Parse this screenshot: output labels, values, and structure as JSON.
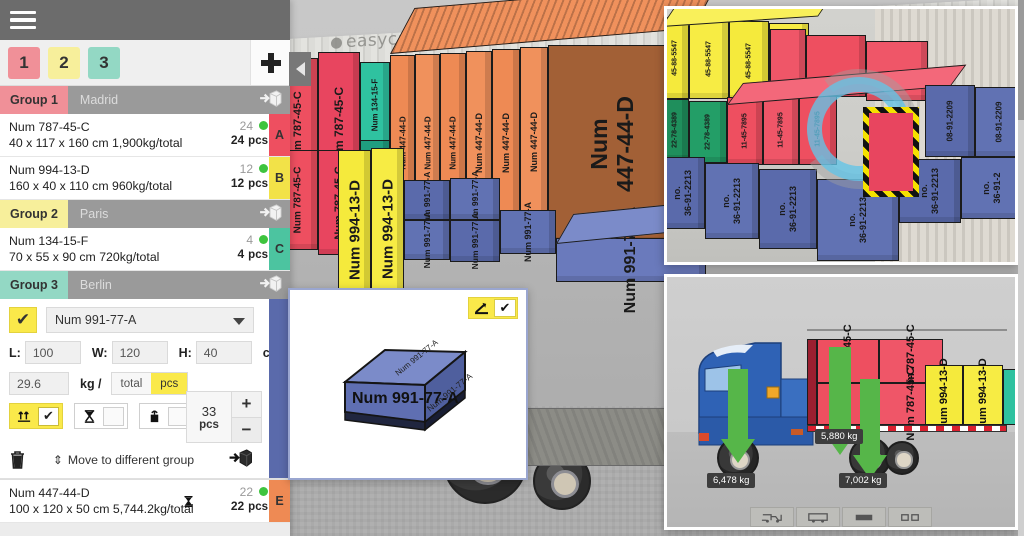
{
  "app": {
    "watermark": "easycargo",
    "menu_icon": "hamburger-icon"
  },
  "sidebar": {
    "tabs": [
      {
        "label": "1",
        "color": "#f09098"
      },
      {
        "label": "2",
        "color": "#f7ef9b"
      },
      {
        "label": "3",
        "color": "#93d8c4"
      }
    ],
    "add_label": "+",
    "groups": [
      {
        "tag": "Group 1",
        "city": "Madrid",
        "color": "#f09098",
        "items": [
          {
            "name": "Num 787-45-C",
            "dimensions": "40 x 117 x 160 cm 1,900kg/total",
            "qty_top": "24",
            "qty_bottom": "24",
            "pcs_label": "pcs",
            "badge": "A",
            "badge_color": "#ee4f60",
            "status_color": "#3ec43e"
          },
          {
            "name": "Num 994-13-D",
            "dimensions": "160 x 40 x 110 cm 960kg/total",
            "qty_top": "12",
            "qty_bottom": "12",
            "pcs_label": "pcs",
            "badge": "B",
            "badge_color": "#f2e248",
            "status_color": "#3ec43e"
          }
        ]
      },
      {
        "tag": "Group 2",
        "city": "Paris",
        "color": "#f7ef9b",
        "items": [
          {
            "name": "Num 134-15-F",
            "dimensions": "70 x 55 x 90 cm 720kg/total",
            "qty_top": "4",
            "qty_bottom": "4",
            "pcs_label": "pcs",
            "badge": "C",
            "badge_color": "#4cc4a0",
            "status_color": "#3ec43e"
          }
        ]
      },
      {
        "tag": "Group 3",
        "city": "Berlin",
        "color": "#93d8c4",
        "items": []
      }
    ],
    "editor": {
      "enabled_check": "✔",
      "selected_item": "Num 991-77-A",
      "length_label": "L:",
      "length_value": "100",
      "width_label": "W:",
      "width_value": "120",
      "height_label": "H:",
      "height_value": "40",
      "dim_unit": "cm",
      "weight_value": "29.6",
      "weight_unit": "kg /",
      "mode_total": "total",
      "mode_pcs": "pcs",
      "qty_value": "33",
      "qty_unit": "pcs",
      "increment": "+",
      "decrement": "−",
      "toggle_this_side_up": "⇈",
      "toggle_this_side_up_check": "✔",
      "toggle_no_stack": "⧖",
      "toggle_fragile": "⚱",
      "trash_icon": "trash-icon",
      "move_label": "Move to different group",
      "add_to_group_icon": "add-box-icon",
      "badge_color": "#5a6aab"
    },
    "last_item": {
      "name": "Num 447-44-D",
      "dimensions": "100 x 120 x 50 cm 5,744.2kg/total",
      "qty_top": "22",
      "qty_bottom": "22",
      "pcs_label": "pcs",
      "badge": "E",
      "badge_color": "#ee8a54",
      "status_color": "#3ec43e",
      "flag_icon": "hourglass-icon"
    }
  },
  "preview": {
    "box_label": "Num 991-77-A",
    "tool_rotate": "✏",
    "tool_confirm": "✔"
  },
  "scene": {
    "collapse_icon": "chevron-left-icon",
    "boxes": [
      {
        "label": "Num 787-45-C",
        "color": "#ee4f60"
      },
      {
        "label": "Num 787-45-C",
        "color": "#ee4f60"
      },
      {
        "label": "Num 134-15-F",
        "color": "#4cc4a0"
      },
      {
        "label": "Num 447-44-D",
        "color": "#ee8a54"
      },
      {
        "label": "Num 447-44-D",
        "color": "#ee8a54"
      },
      {
        "label": "Num 447-44-D",
        "color": "#ee8a54"
      },
      {
        "label": "Num 447-44-D",
        "color": "#ee8a54"
      },
      {
        "label": "Num 447-44-D",
        "color": "#ee8a54"
      },
      {
        "label": "Num 447-44-D",
        "color": "#ee8a54"
      },
      {
        "label": "Num 994-13-D",
        "color": "#f2e248"
      },
      {
        "label": "Num 994-13-D",
        "color": "#f2e248"
      },
      {
        "label": "Num 991-77-A",
        "color": "#5a6aab"
      },
      {
        "label": "Num 991-77-A",
        "color": "#5a6aab"
      },
      {
        "label": "Num 991-77-A",
        "color": "#5a6aab"
      },
      {
        "label": "Num 991-77-A",
        "color": "#5a6aab"
      },
      {
        "label": "Num 991-77-A",
        "color": "#5a6aab"
      },
      {
        "label": "Num 991-77-A",
        "color": "#5a6aab"
      }
    ],
    "big_box_label": "Num 447-44-D"
  },
  "panel_top_right": {
    "crate_numbers": [
      "45-88-5547",
      "45-88-5547",
      "45-88-5547",
      "22-78-4389",
      "22-78-4389",
      "11-45-7895",
      "11-45-7895",
      "11-45-7895",
      "36-91-2213",
      "36-91-2213",
      "36-91-2213",
      "36-91-2213",
      "08-91-2209"
    ],
    "no_prefix": "no.",
    "rotation_icon": "rotate-arrow-icon",
    "highlight_icon": "hazard-border-icon"
  },
  "panel_bottom_right": {
    "axle_loads": [
      "6,478 kg",
      "5,880 kg",
      "7,002 kg"
    ],
    "cargo_labels": [
      "Num 787-45-C",
      "Num 787-45-C",
      "Num 787-45-C",
      "Num 787-45-C",
      "Num 994-13-D",
      "Num 994-13-D"
    ],
    "toolbar_icons": [
      "truck-icon",
      "trailer-icon",
      "container-icon",
      "pallet-icon"
    ]
  }
}
